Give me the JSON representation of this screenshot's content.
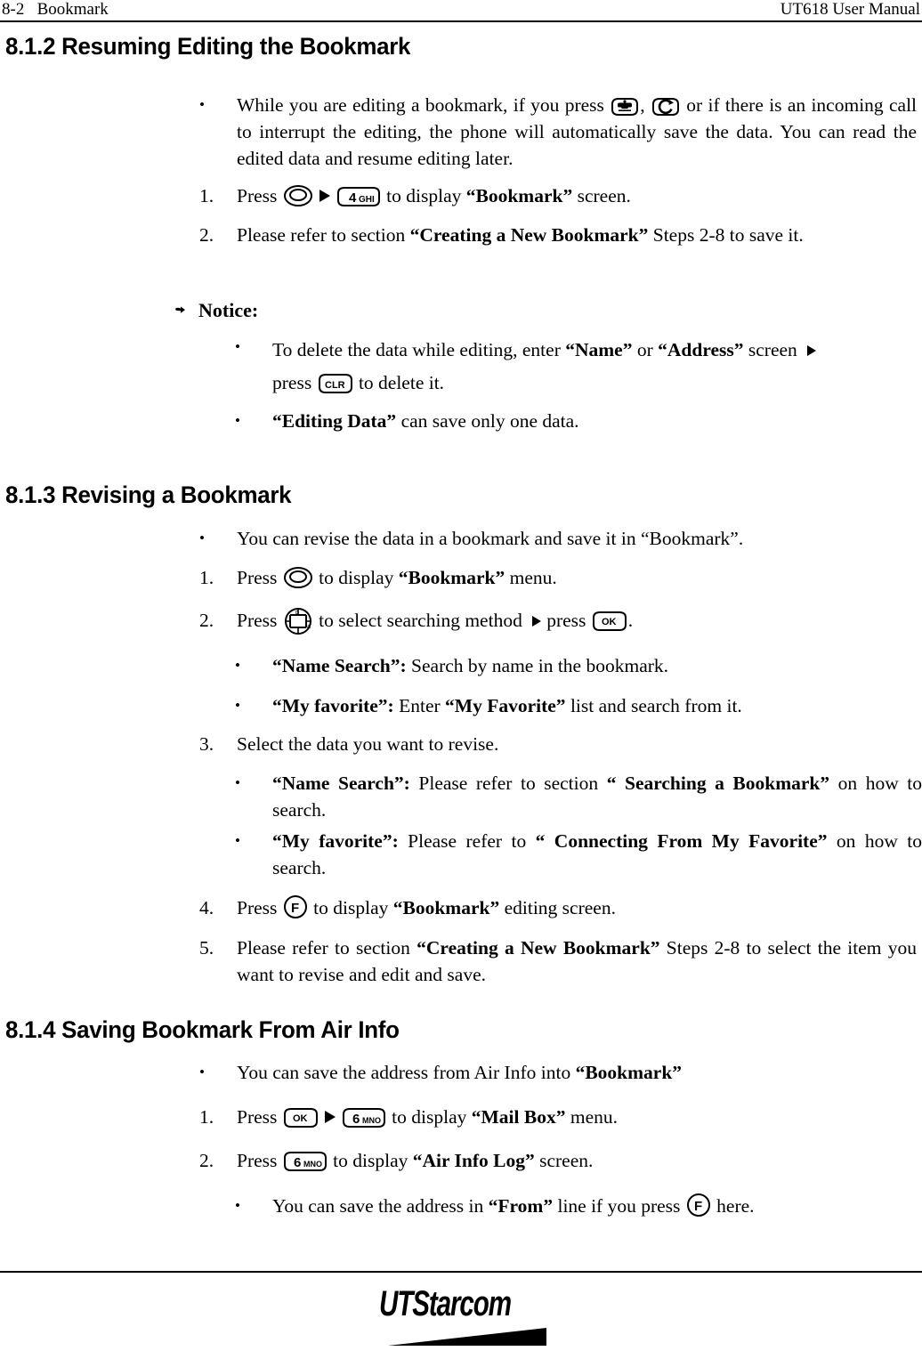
{
  "header": {
    "left": "8-2   Bookmark",
    "right": "UT618 User Manual"
  },
  "footer": {
    "logo_ut": "UT",
    "logo_starcom": "Starcom"
  },
  "sections": [
    {
      "id": "8.1.2",
      "heading": "8.1.2 Resuming Editing the Bookmark"
    },
    {
      "id": "8.1.3",
      "heading": "8.1.3 Revising a Bookmark"
    },
    {
      "id": "8.1.4",
      "heading": "8.1.4 Saving Bookmark From Air Info"
    }
  ],
  "s812": {
    "bullet1_a": "While you are editing a bookmark, if you press ",
    "bullet1_b": ", ",
    "bullet1_c": " or if there is an incoming call to interrupt the editing, the phone will automatically save the data. You can read the edited data and resume editing later.",
    "item1_marker": "1.",
    "item1_a": "Press ",
    "item1_b": " to display ",
    "item1_bold": "“Bookmark”",
    "item1_c": " screen.",
    "item2_marker": "2.",
    "item2_a": "Please refer to section ",
    "item2_bold": "“Creating a New Bookmark”",
    "item2_b": " Steps 2-8 to save it."
  },
  "notice": {
    "title": "Notice:",
    "b1_a": "To delete the data while editing, enter ",
    "b1_bold1": "“Name”",
    "b1_b": " or ",
    "b1_bold2": "“Address”",
    "b1_c": " screen ",
    "b1_d": "press ",
    "b1_e": " to delete it.",
    "b2_bold": "“Editing Data”",
    "b2_text": " can save only one data."
  },
  "s813": {
    "bullet1": "You can revise the data in a bookmark and save it in “Bookmark”.",
    "item1_marker": "1.",
    "item1_a": "Press ",
    "item1_b": " to display ",
    "item1_bold": "“Bookmark”",
    "item1_c": " menu.",
    "item2_marker": "2.",
    "item2_a": "Press ",
    "item2_b": " to select searching method ",
    "item2_c": "press ",
    "item2_d": ".",
    "sub1_bold": "“Name Search”:",
    "sub1_text": " Search by name in the bookmark.",
    "sub2_bold": "“My favorite”:",
    "sub2_text_a": " Enter ",
    "sub2_bold2": "“My Favorite”",
    "sub2_text_b": " list and search from it.",
    "item3_marker": "3.",
    "item3_text": "Select the data you want to revise.",
    "sub3_bold": "“Name Search”:",
    "sub3_text_a": " Please refer to section ",
    "sub3_bold2": "“ Searching a Bookmark”",
    "sub3_text_b": " on how to search.",
    "sub4_bold": "“My favorite”:",
    "sub4_text_a": " Please refer to ",
    "sub4_bold2": "“ Connecting From My Favorite”",
    "sub4_text_b": " on how to search.",
    "item4_marker": "4.",
    "item4_a": "Press ",
    "item4_b": " to display ",
    "item4_bold": "“Bookmark”",
    "item4_c": " editing screen.",
    "item5_marker": "5.",
    "item5_a": "Please refer to section ",
    "item5_bold": "“Creating a New Bookmark”",
    "item5_b": " Steps 2-8 to select the item you want to revise and edit and save."
  },
  "s814": {
    "bullet1_a": "You can save the address from Air Info into ",
    "bullet1_bold": "“Bookmark”",
    "item1_marker": "1.",
    "item1_a": "Press ",
    "item1_b": " to display ",
    "item1_bold": "“Mail Box”",
    "item1_c": " menu.",
    "item2_marker": "2.",
    "item2_a": "Press ",
    "item2_b": " to display ",
    "item2_bold": "“Air Info Log”",
    "item2_c": " screen.",
    "sub1_a": "You can save the address in ",
    "sub1_bold": "“From”",
    "sub1_b": " line if you press ",
    "sub1_c": " here."
  },
  "icons": {
    "send_key": "phone-send-key-icon",
    "end_key": "power-end-key-icon",
    "nav_key": "navigation-key-icon",
    "nav_key_4way": "four-way-navigation-key-icon",
    "key4ghi_label": "4",
    "key4ghi_sub": "GHI",
    "key6mno_label": "6",
    "key6mno_sub": "MNO",
    "clr_label": "CLR",
    "ok_label": "OK",
    "f_label": "F",
    "arrow": "right-arrow-icon",
    "notice_hand": "pointing-hand-icon"
  },
  "bullets": {
    "disc": "•"
  }
}
